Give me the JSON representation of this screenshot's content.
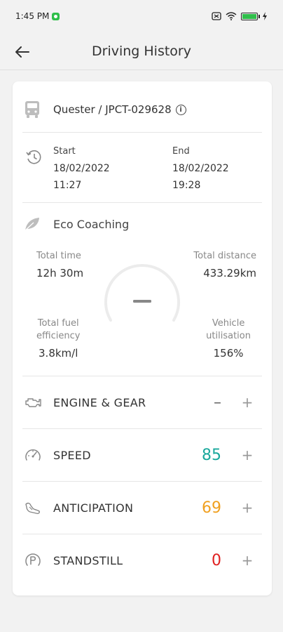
{
  "status_bar": {
    "time": "1:45 PM",
    "battery_charging_icon": "bolt-icon"
  },
  "header": {
    "title": "Driving History"
  },
  "vehicle": {
    "name": "Quester / JPCT-029628",
    "info_icon_glyph": "i"
  },
  "trip": {
    "start_label": "Start",
    "start_date": "18/02/2022",
    "start_time": "11:27",
    "end_label": "End",
    "end_date": "18/02/2022",
    "end_time": "19:28"
  },
  "eco": {
    "label": "Eco Coaching",
    "total_time_label": "Total time",
    "total_time_value": "12h 30m",
    "total_distance_label": "Total distance",
    "total_distance_value": "433.29km",
    "fuel_label_1": "Total fuel",
    "fuel_label_2": "efficiency",
    "fuel_value": "3.8km/l",
    "util_label_1": "Vehicle",
    "util_label_2": "utilisation",
    "util_value": "156%"
  },
  "scores": [
    {
      "label": "ENGINE & GEAR",
      "value": "–",
      "color": "#666666",
      "icon": "engine-icon"
    },
    {
      "label": "SPEED",
      "value": "85",
      "color": "#1aa89c",
      "icon": "speedometer-icon"
    },
    {
      "label": "ANTICIPATION",
      "value": "69",
      "color": "#f0a020",
      "icon": "anticipation-icon"
    },
    {
      "label": "STANDSTILL",
      "value": "0",
      "color": "#e02020",
      "icon": "parking-icon"
    }
  ],
  "plus_glyph": "+"
}
